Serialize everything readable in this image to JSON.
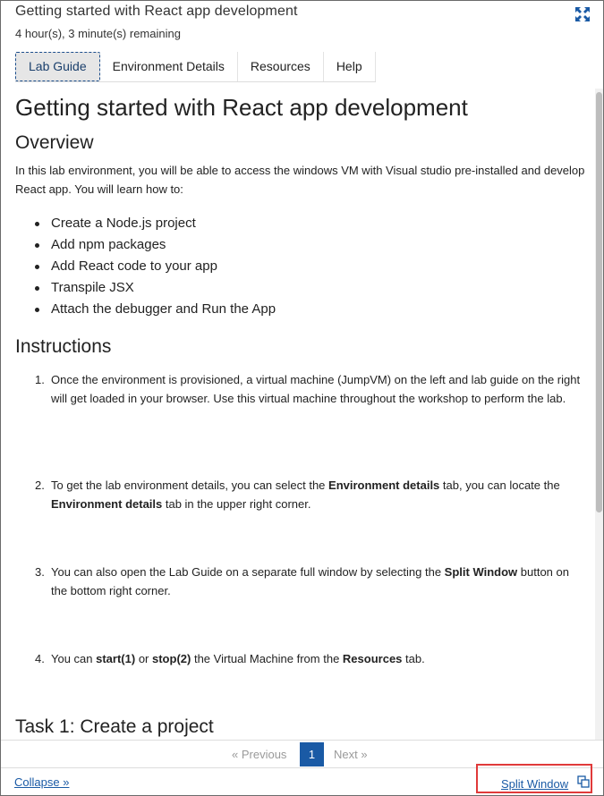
{
  "header": {
    "title": "Getting started with React app development",
    "timer": "4 hour(s), 3 minute(s) remaining"
  },
  "tabs": [
    {
      "label": "Lab Guide",
      "active": true
    },
    {
      "label": "Environment Details",
      "active": false
    },
    {
      "label": "Resources",
      "active": false
    },
    {
      "label": "Help",
      "active": false
    }
  ],
  "content": {
    "title": "Getting started with React app development",
    "overview_heading": "Overview",
    "intro": "In this lab environment, you will be able to access the windows VM with Visual studio pre-installed and develop React app. You will learn how to:",
    "bullets": [
      "Create a Node.js project",
      "Add npm packages",
      "Add React code to your app",
      "Transpile JSX",
      "Attach the debugger and Run the App"
    ],
    "instructions_heading": "Instructions",
    "steps": [
      {
        "num": "1.",
        "t1": "Once the environment is provisioned, a virtual machine (JumpVM) on the left and lab guide on the right will get loaded in your browser. Use this virtual machine throughout the workshop to perform the lab."
      },
      {
        "num": "2.",
        "t1": "To get the lab environment details, you can select the ",
        "b1": "Environment details",
        "t2": " tab, you can locate the ",
        "b2": "Environment details",
        "t3": " tab in the upper right corner."
      },
      {
        "num": "3.",
        "t1": "You can also open the Lab Guide on a separate full window by selecting the ",
        "b1": "Split Window",
        "t2": " button on the bottom right corner."
      },
      {
        "num": "4.",
        "t1": "You can ",
        "b1": "start(1)",
        "t2": " or ",
        "b2": "stop(2)",
        "t3": " the Virtual Machine from the ",
        "b3": "Resources",
        "t4": " tab."
      }
    ],
    "task_heading": "Task 1: Create a project"
  },
  "pagination": {
    "previous": "« Previous",
    "current": "1",
    "next": "Next »"
  },
  "footer": {
    "collapse": "Collapse »",
    "split_window": "Split Window"
  },
  "colors": {
    "accent": "#1a5aa5",
    "highlight_box": "#e03a3a",
    "active_tab_bg": "#e6e6e6"
  },
  "icons": {
    "expand": "expand-arrows-icon",
    "split": "split-window-icon"
  }
}
